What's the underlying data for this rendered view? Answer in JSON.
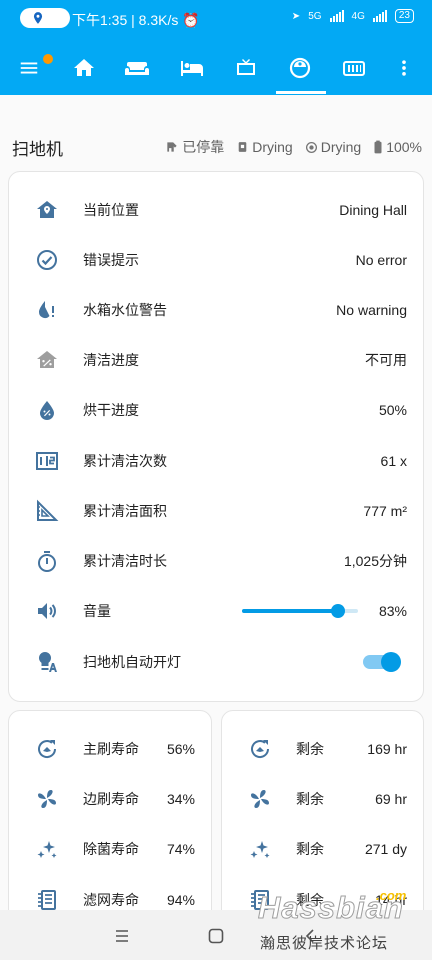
{
  "status_bar": {
    "time": "下午1:35",
    "speed": "8.3K/s",
    "net1": "5G",
    "net2": "4G",
    "battery": "23"
  },
  "app_bar": {
    "tabs": [
      "menu",
      "home",
      "sofa",
      "bed",
      "tv",
      "robot-vacuum",
      "remote"
    ],
    "active_tab": "robot-vacuum"
  },
  "header": {
    "title": "扫地机",
    "status_items": [
      "已停靠",
      "Drying",
      "Drying",
      "100%"
    ]
  },
  "main_card": {
    "rows": [
      {
        "label": "当前位置",
        "value": "Dining Hall",
        "icon": "home-map-marker-icon"
      },
      {
        "label": "错误提示",
        "value": "No error",
        "icon": "check-circle-icon"
      },
      {
        "label": "水箱水位警告",
        "value": "No warning",
        "icon": "water-alert-icon"
      },
      {
        "label": "清洁进度",
        "value": "不可用",
        "icon": "home-percent-icon"
      },
      {
        "label": "烘干进度",
        "value": "50%",
        "icon": "water-percent-icon"
      },
      {
        "label": "累计清洁次数",
        "value": "61 x",
        "icon": "counter-icon"
      },
      {
        "label": "累计清洁面积",
        "value": "777 m²",
        "icon": "set-square-icon"
      },
      {
        "label": "累计清洁时长",
        "value": "1,025分钟",
        "icon": "timer-icon"
      },
      {
        "label": "音量",
        "value": "83%",
        "icon": "volume-icon"
      },
      {
        "label": "扫地机自动开灯",
        "value": "",
        "icon": "lightbulb-auto-icon"
      }
    ],
    "volume_level": 0.83,
    "auto_light_on": true
  },
  "life_card": {
    "rows": [
      {
        "label": "主刷寿命",
        "value": "56%",
        "icon": "main-brush-icon"
      },
      {
        "label": "边刷寿命",
        "value": "34%",
        "icon": "side-brush-icon"
      },
      {
        "label": "除菌寿命",
        "value": "74%",
        "icon": "sterilize-icon"
      },
      {
        "label": "滤网寿命",
        "value": "94%",
        "icon": "filter-icon"
      }
    ]
  },
  "remain_card": {
    "rows": [
      {
        "label": "剩余",
        "value": "169 hr",
        "icon": "main-brush-icon"
      },
      {
        "label": "剩余",
        "value": "69 hr",
        "icon": "side-brush-icon"
      },
      {
        "label": "剩余",
        "value": "271 dy",
        "icon": "sterilize-icon"
      },
      {
        "label": "剩余",
        "value": "14 hr",
        "icon": "filter-icon"
      }
    ]
  },
  "watermark": {
    "brand": "Hassbian",
    "suffix": ".com",
    "tagline": "瀚思彼岸技术论坛"
  },
  "colors": {
    "primary": "#03a9f4",
    "icon": "#44739e",
    "accent": "#039be5"
  }
}
